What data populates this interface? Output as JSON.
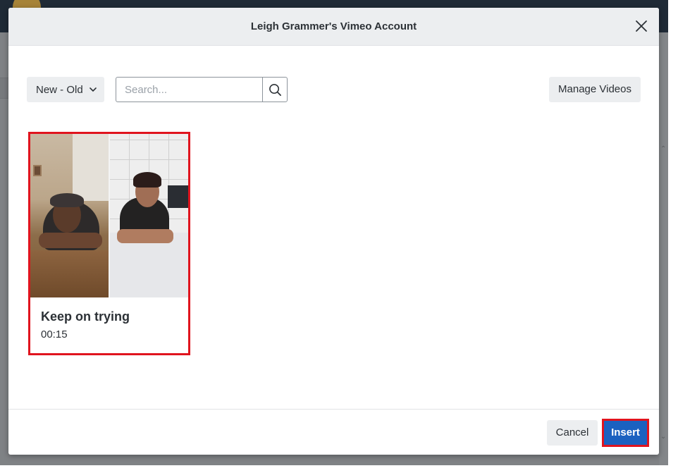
{
  "modal": {
    "title": "Leigh Grammer's Vimeo Account"
  },
  "toolbar": {
    "sort_value": "New - Old",
    "search_placeholder": "Search...",
    "search_value": "",
    "manage_label": "Manage Videos"
  },
  "videos": [
    {
      "title": "Keep on trying",
      "duration": "00:15",
      "selected": true
    }
  ],
  "footer": {
    "cancel_label": "Cancel",
    "insert_label": "Insert"
  },
  "colors": {
    "accent": "#1b61c0",
    "selection_outline": "#e0141e",
    "header_bg": "#eceef0"
  },
  "icons": {
    "close": "close-icon",
    "search": "search-icon",
    "sort_chevron": "chevron-down-icon"
  }
}
